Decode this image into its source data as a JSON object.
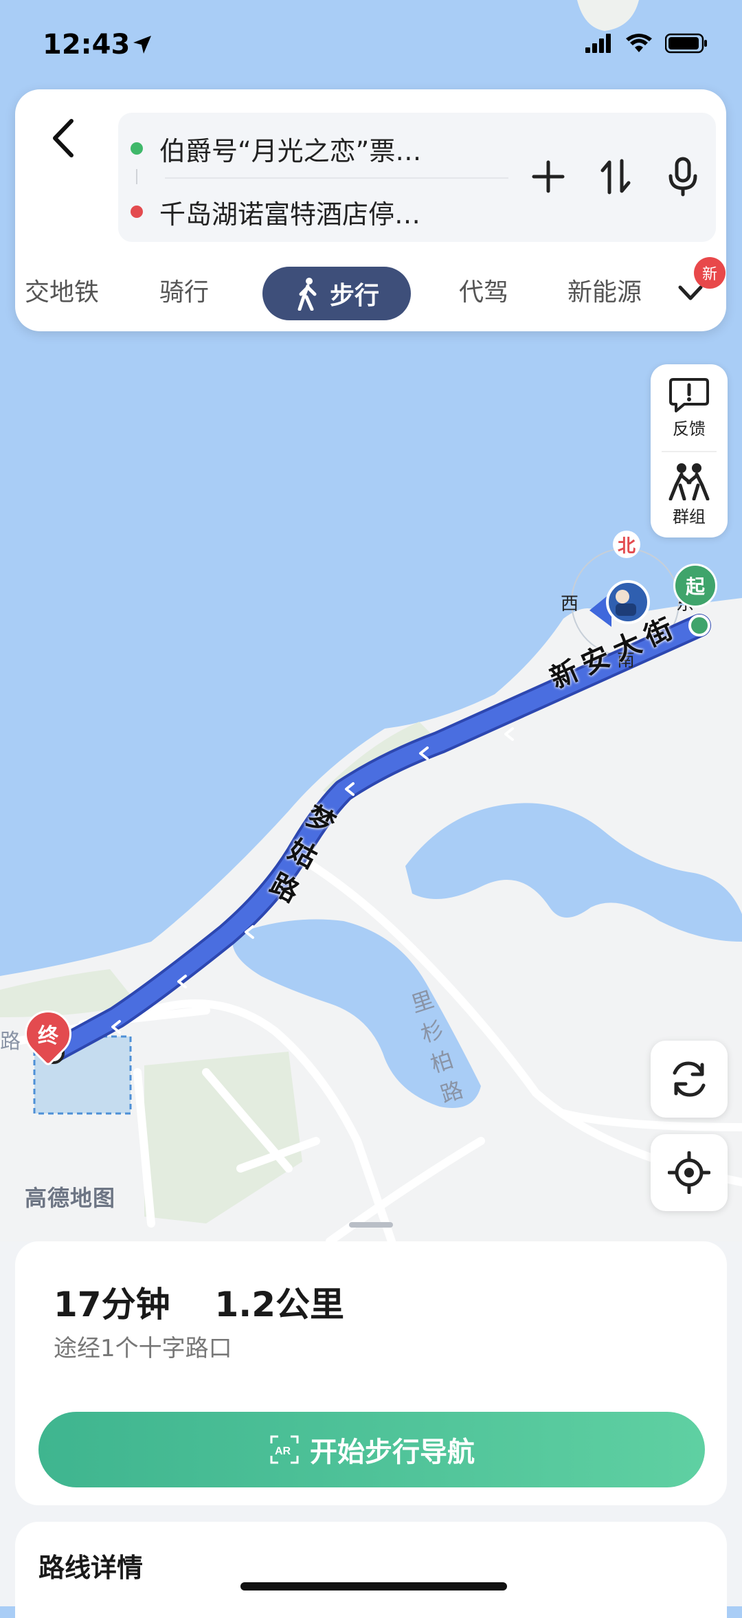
{
  "status_bar": {
    "time": "12:43"
  },
  "search": {
    "origin": "伯爵号“月光之恋”票…",
    "destination": "千岛湖诺富特酒店停…"
  },
  "modes": {
    "items": [
      "交地铁",
      "骑行",
      "步行",
      "代驾",
      "新能源"
    ],
    "active": "步行",
    "new_badge": "新"
  },
  "side_panel": {
    "feedback_label": "反馈",
    "group_label": "群组"
  },
  "compass": {
    "north": "北",
    "south": "南",
    "east": "东",
    "west": "西"
  },
  "map": {
    "start_label": "起",
    "end_label": "终",
    "road_xinan": "新安大街",
    "road_menggu": "梦姑路",
    "road_lishan": "里杉柏路",
    "road_left": "路",
    "logo": "高德地图"
  },
  "route": {
    "duration": "17分钟",
    "distance": "1.2公里",
    "via": "途经1个十字路口",
    "start_button": "开始步行导航",
    "detail_title": "路线详情"
  },
  "colors": {
    "water": "#a9cdf6",
    "land": "#f2f3f4",
    "route": "#4a6ee0",
    "start_green": "#3fa46b",
    "end_red": "#e34b4f",
    "active_mode": "#3e4f7a",
    "nav_button": "#4fc49a"
  }
}
